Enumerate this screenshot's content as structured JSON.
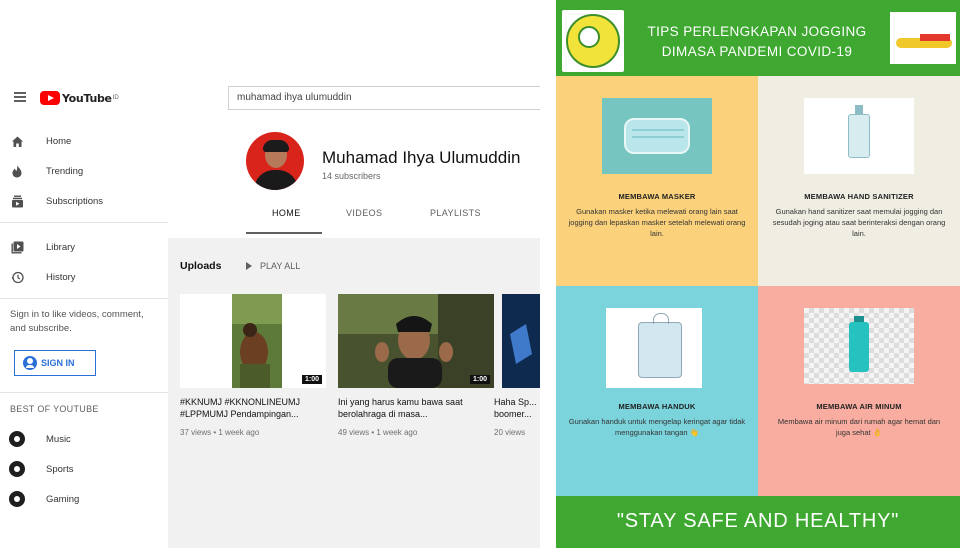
{
  "youtube": {
    "logo_text": "YouTube",
    "logo_sup": "ID",
    "search_value": "muhamad ihya ulumuddin",
    "sidebar": {
      "primary": [
        {
          "label": "Home",
          "icon": "home-icon"
        },
        {
          "label": "Trending",
          "icon": "fire-icon"
        },
        {
          "label": "Subscriptions",
          "icon": "subscriptions-icon"
        }
      ],
      "secondary": [
        {
          "label": "Library",
          "icon": "library-icon"
        },
        {
          "label": "History",
          "icon": "history-icon"
        }
      ],
      "signin_prompt": "Sign in to like videos, comment, and subscribe.",
      "signin_button": "SIGN IN",
      "best_heading": "BEST OF YOUTUBE",
      "categories": [
        {
          "label": "Music",
          "icon": "music-icon"
        },
        {
          "label": "Sports",
          "icon": "sports-icon"
        },
        {
          "label": "Gaming",
          "icon": "gaming-icon"
        }
      ]
    },
    "channel": {
      "name": "Muhamad Ihya Ulumuddin",
      "subscribers": "14 subscribers",
      "tabs": [
        "HOME",
        "VIDEOS",
        "PLAYLISTS"
      ]
    },
    "uploads": {
      "label": "Uploads",
      "play_all": "PLAY ALL",
      "videos": [
        {
          "title": "#KKNUMJ #KKNONLINEUMJ #LPPMUMJ Pendampingan...",
          "meta": "37 views • 1 week ago",
          "duration": "1:00"
        },
        {
          "title": "Ini yang harus kamu bawa saat berolahraga di masa...",
          "meta": "49 views • 1 week ago",
          "duration": "1:00"
        },
        {
          "title": "Haha Sp... boomer...",
          "meta": "20 views",
          "duration": ""
        }
      ]
    }
  },
  "poster": {
    "title_line1": "TIPS PERLENGKAPAN JOGGING",
    "title_line2": "DIMASA PANDEMI COVID-19",
    "tips": [
      {
        "heading": "MEMBAWA MASKER",
        "body": "Gunakan masker ketika melewati orang lain saat jogging dan lepaskan masker setelah melewati orang lain."
      },
      {
        "heading": "MEMBAWA HAND SANITIZER",
        "body": "Gunakan hand sanitizer saat memulai jogging dan sesudah joging atau saat berinteraksi dengan orang lain."
      },
      {
        "heading": "MEMBAWA HANDUK",
        "body": "Gunakan handuk untuk mengelap keringat agar tidak menggunakan tangan 👋"
      },
      {
        "heading": "MEMBAWA AIR MINUM",
        "body": "Membawa air minum dari rumah agar hemat dan juga sehat 👌"
      }
    ],
    "footer": "\"STAY SAFE AND HEALTHY\""
  },
  "colors": {
    "youtube_red": "#ff0000",
    "poster_green": "#3ea830",
    "tip_yellow": "#fbd27b",
    "tip_cream": "#f0ede3",
    "tip_cyan": "#7bd4dc",
    "tip_pink": "#f8ada0"
  }
}
